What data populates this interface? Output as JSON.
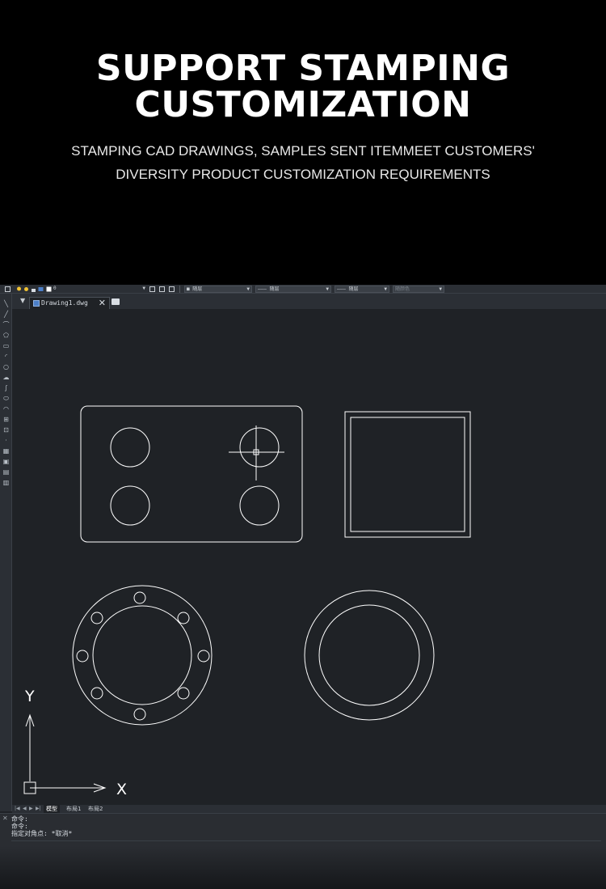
{
  "hero": {
    "title": "SUPPORT STAMPING\nCUSTOMIZATION",
    "subtitle_line1": "STAMPING CAD DRAWINGS, SAMPLES SENT ITEMMEET CUSTOMERS'",
    "subtitle_line2": "DIVERSITY PRODUCT CUSTOMIZATION REQUIREMENTS"
  },
  "cad": {
    "toolbar": {
      "layer_value": "0",
      "color_value": "■ 随层",
      "linetype_value": "——— 随层",
      "lineweight_value": "——— 随层",
      "plotstyle_value": "随颜色"
    },
    "tab": {
      "menu_glyph": "▼",
      "file_name": "Drawing1.dwg",
      "close_glyph": "✕"
    },
    "axis": {
      "x_label": "X",
      "y_label": "Y"
    },
    "layout_tabs": [
      "模型",
      "布局1",
      "布局2"
    ],
    "command_lines": [
      "命令:",
      "命令:",
      "指定对角点: *取消*"
    ],
    "colors": {
      "background": "#1f2226",
      "panel": "#2b2f35",
      "stroke": "#ffffff"
    }
  }
}
